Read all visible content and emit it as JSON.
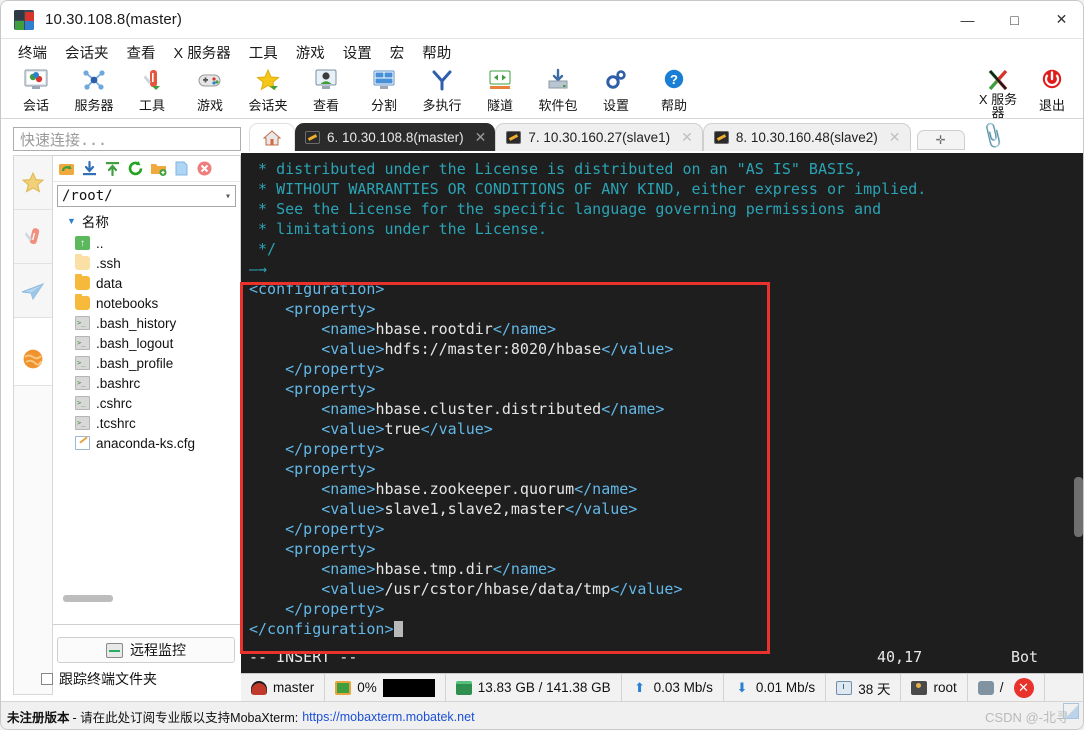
{
  "window": {
    "title": "10.30.108.8(master)",
    "icon": "mobaxterm-logo-icon",
    "minimize": "—",
    "maximize": "□",
    "close": "✕"
  },
  "menubar": {
    "items": [
      {
        "label": "终端",
        "name": "menu-terminal"
      },
      {
        "label": "会话夹",
        "name": "menu-sessions"
      },
      {
        "label": "查看",
        "name": "menu-view"
      },
      {
        "label": "X 服务器",
        "name": "menu-xserver"
      },
      {
        "label": "工具",
        "name": "menu-tools"
      },
      {
        "label": "游戏",
        "name": "menu-games"
      },
      {
        "label": "设置",
        "name": "menu-settings"
      },
      {
        "label": "宏",
        "name": "menu-macros"
      },
      {
        "label": "帮助",
        "name": "menu-help"
      }
    ]
  },
  "toolbar": {
    "buttons": [
      {
        "label": "会话",
        "icon": "session-icon"
      },
      {
        "label": "服务器",
        "icon": "servers-icon"
      },
      {
        "label": "工具",
        "icon": "tools-icon"
      },
      {
        "label": "游戏",
        "icon": "games-icon"
      },
      {
        "label": "会话夹",
        "icon": "sessions-star-icon"
      },
      {
        "label": "查看",
        "icon": "view-icon"
      },
      {
        "label": "分割",
        "icon": "split-icon"
      },
      {
        "label": "多执行",
        "icon": "multiexec-icon"
      },
      {
        "label": "隧道",
        "icon": "tunneling-icon"
      },
      {
        "label": "软件包",
        "icon": "packages-icon"
      },
      {
        "label": "设置",
        "icon": "settings-gear-icon"
      },
      {
        "label": "帮助",
        "icon": "help-question-icon"
      }
    ],
    "right": [
      {
        "label_line1": "X 服务",
        "label_line2": "器",
        "icon": "x-server-icon"
      },
      {
        "label_line1": "退出",
        "label_line2": "",
        "icon": "exit-power-icon"
      }
    ]
  },
  "quick_connect": {
    "placeholder": "快速连接..."
  },
  "side_strip": {
    "items": [
      {
        "icon": "star-favorites-icon",
        "selected": false
      },
      {
        "icon": "tools-knife-icon",
        "selected": false
      },
      {
        "icon": "paperplane-send-icon",
        "selected": false
      },
      {
        "icon": "globe-macros-icon",
        "selected": true
      }
    ]
  },
  "file_panel": {
    "toolbar_icons": [
      "go-up-icon",
      "download-icon",
      "upload-icon",
      "refresh-icon",
      "new-folder-icon",
      "new-file-icon",
      "delete-icon"
    ],
    "path": "/root/",
    "column_header": "名称",
    "sort_indicator": "▼",
    "entries": [
      {
        "name": "..",
        "type": "up"
      },
      {
        "name": ".ssh",
        "type": "folder-pale"
      },
      {
        "name": "data",
        "type": "folder"
      },
      {
        "name": "notebooks",
        "type": "folder"
      },
      {
        "name": ".bash_history",
        "type": "file"
      },
      {
        "name": ".bash_logout",
        "type": "file"
      },
      {
        "name": ".bash_profile",
        "type": "file"
      },
      {
        "name": ".bashrc",
        "type": "file"
      },
      {
        "name": ".cshrc",
        "type": "file"
      },
      {
        "name": ".tcshrc",
        "type": "file"
      },
      {
        "name": "anaconda-ks.cfg",
        "type": "cfg"
      }
    ],
    "monitor_button": "远程监控",
    "follow_terminal_folder": "跟踪终端文件夹"
  },
  "tabs": {
    "home_icon": "home-icon",
    "items": [
      {
        "label": "6. 10.30.108.8(master)",
        "active": true,
        "icon": "key-icon",
        "close": "✕"
      },
      {
        "label": "7. 10.30.160.27(slave1)",
        "active": false,
        "icon": "key-icon",
        "close": "✕"
      },
      {
        "label": "8. 10.30.160.48(slave2)",
        "active": false,
        "icon": "key-icon",
        "close": "✕"
      }
    ],
    "new_tab": "✛",
    "clip_icon": "paperclip-icon"
  },
  "terminal": {
    "lines": [
      {
        "segments": [
          {
            "t": " * distributed under the License is distributed on an \"AS IS\" BASIS,",
            "c": "c-comment"
          }
        ]
      },
      {
        "segments": [
          {
            "t": " * WITHOUT WARRANTIES OR CONDITIONS OF ANY KIND, either express or implied.",
            "c": "c-comment"
          }
        ]
      },
      {
        "segments": [
          {
            "t": " * See the License for the specific language governing permissions and",
            "c": "c-comment"
          }
        ]
      },
      {
        "segments": [
          {
            "t": " * limitations under the License.",
            "c": "c-comment"
          }
        ]
      },
      {
        "segments": [
          {
            "t": " */",
            "c": "c-comment"
          }
        ]
      },
      {
        "segments": [
          {
            "t": "—→",
            "c": "c-arrow"
          }
        ]
      },
      {
        "segments": [
          {
            "t": "<configuration>",
            "c": "c-tag"
          }
        ]
      },
      {
        "segments": [
          {
            "t": "    <property>",
            "c": "c-tag"
          }
        ]
      },
      {
        "segments": [
          {
            "t": "        <name>",
            "c": "c-tag"
          },
          {
            "t": "hbase.rootdir",
            "c": "c-text"
          },
          {
            "t": "</name>",
            "c": "c-tag"
          }
        ]
      },
      {
        "segments": [
          {
            "t": "        <value>",
            "c": "c-tag"
          },
          {
            "t": "hdfs://master:8020/hbase",
            "c": "c-text"
          },
          {
            "t": "</value>",
            "c": "c-tag"
          }
        ]
      },
      {
        "segments": [
          {
            "t": "    </property>",
            "c": "c-tag"
          }
        ]
      },
      {
        "segments": [
          {
            "t": "    <property>",
            "c": "c-tag"
          }
        ]
      },
      {
        "segments": [
          {
            "t": "        <name>",
            "c": "c-tag"
          },
          {
            "t": "hbase.cluster.distributed",
            "c": "c-text"
          },
          {
            "t": "</name>",
            "c": "c-tag"
          }
        ]
      },
      {
        "segments": [
          {
            "t": "        <value>",
            "c": "c-tag"
          },
          {
            "t": "true",
            "c": "c-text"
          },
          {
            "t": "</value>",
            "c": "c-tag"
          }
        ]
      },
      {
        "segments": [
          {
            "t": "    </property>",
            "c": "c-tag"
          }
        ]
      },
      {
        "segments": [
          {
            "t": "    <property>",
            "c": "c-tag"
          }
        ]
      },
      {
        "segments": [
          {
            "t": "        <name>",
            "c": "c-tag"
          },
          {
            "t": "hbase.zookeeper.quorum",
            "c": "c-text"
          },
          {
            "t": "</name>",
            "c": "c-tag"
          }
        ]
      },
      {
        "segments": [
          {
            "t": "        <value>",
            "c": "c-tag"
          },
          {
            "t": "slave1,slave2,master",
            "c": "c-text"
          },
          {
            "t": "</value>",
            "c": "c-tag"
          }
        ]
      },
      {
        "segments": [
          {
            "t": "    </property>",
            "c": "c-tag"
          }
        ]
      },
      {
        "segments": [
          {
            "t": "    <property>",
            "c": "c-tag"
          }
        ]
      },
      {
        "segments": [
          {
            "t": "        <name>",
            "c": "c-tag"
          },
          {
            "t": "hbase.tmp.dir",
            "c": "c-text"
          },
          {
            "t": "</name>",
            "c": "c-tag"
          }
        ]
      },
      {
        "segments": [
          {
            "t": "        <value>",
            "c": "c-tag"
          },
          {
            "t": "/usr/cstor/hbase/data/tmp",
            "c": "c-text"
          },
          {
            "t": "</value>",
            "c": "c-tag"
          }
        ]
      },
      {
        "segments": [
          {
            "t": "    </property>",
            "c": "c-tag"
          }
        ]
      },
      {
        "segments": [
          {
            "t": "</configuration>",
            "c": "c-tag"
          },
          {
            "t": "§CURSOR§",
            "c": "cursor"
          }
        ]
      }
    ],
    "vim_mode": "-- INSERT --",
    "cursor_position": "40,17",
    "scroll_indicator": "Bot"
  },
  "status_bar": {
    "host": "master",
    "host_icon": "redhat-icon",
    "cpu": "0%",
    "cpu_icon": "cpu-icon",
    "cpu_graph": "cpu-graph",
    "memory": "13.83 GB / 141.38 GB",
    "memory_icon": "ram-icon",
    "upload": "0.03 Mb/s",
    "upload_icon": "upload-arrow-icon",
    "download": "0.01 Mb/s",
    "download_icon": "download-arrow-icon",
    "uptime": "38 天",
    "uptime_icon": "uptime-icon",
    "user": "root",
    "user_icon": "user-icon",
    "disk": "/",
    "disk_icon": "disk-icon",
    "close": "✕"
  },
  "bottom_bar": {
    "unregistered": "未注册版本",
    "message": "- 请在此处订阅专业版以支持MobaXterm:",
    "link": "https://mobaxterm.mobatek.net",
    "watermark": "CSDN @-北寻"
  },
  "colors": {
    "terminal_bg": "#1e1e1e",
    "comment": "#2aa3b5",
    "tag": "#63b8e8",
    "text": "#e6e6e6",
    "highlight_box": "#e8322b",
    "accent_blue": "#2d7fd3",
    "link": "#1a4fd6"
  }
}
